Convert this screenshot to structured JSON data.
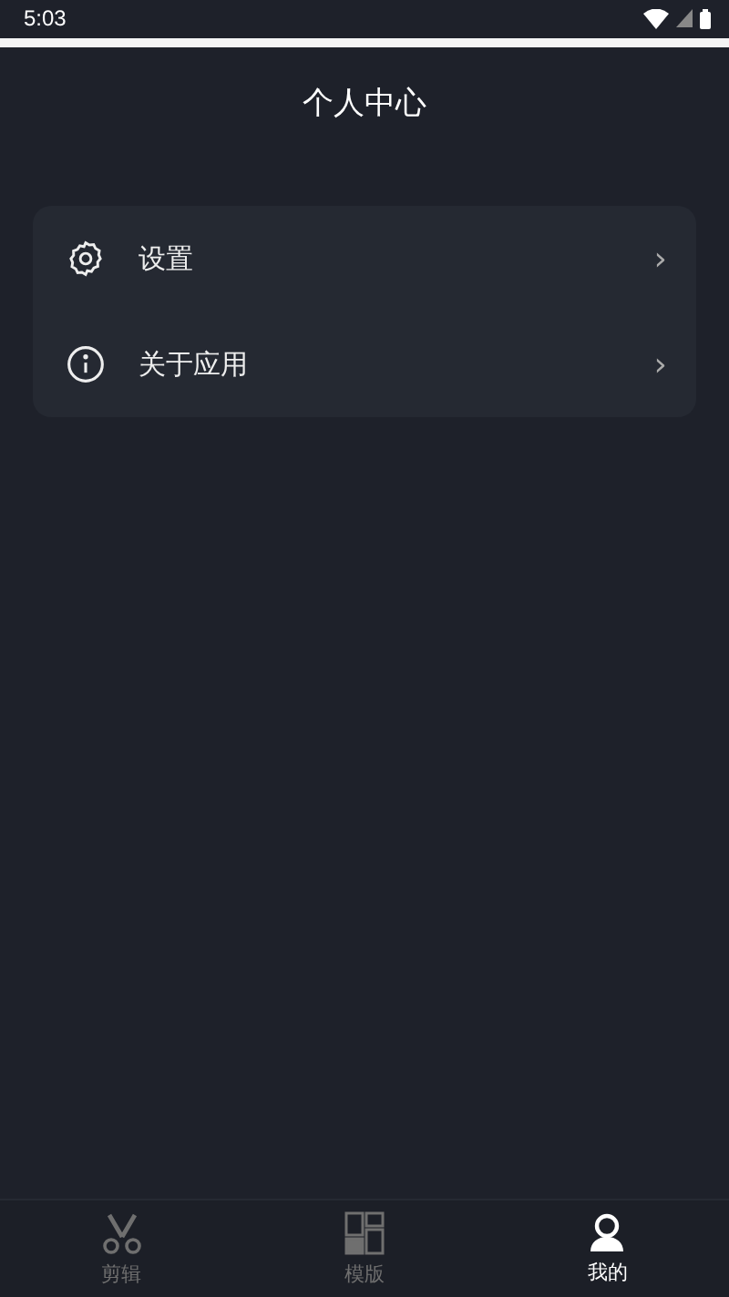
{
  "status_bar": {
    "time": "5:03"
  },
  "header": {
    "title": "个人中心"
  },
  "menu": [
    {
      "kind": "settings",
      "label": "设置",
      "chevron": "›"
    },
    {
      "kind": "info",
      "label": "关于应用",
      "chevron": "›"
    }
  ],
  "tab_bar": [
    {
      "kind": "edit",
      "label": "剪辑",
      "selected": false
    },
    {
      "kind": "template",
      "label": "模版",
      "selected": false
    },
    {
      "kind": "profile",
      "label": "我的",
      "selected": true
    }
  ]
}
